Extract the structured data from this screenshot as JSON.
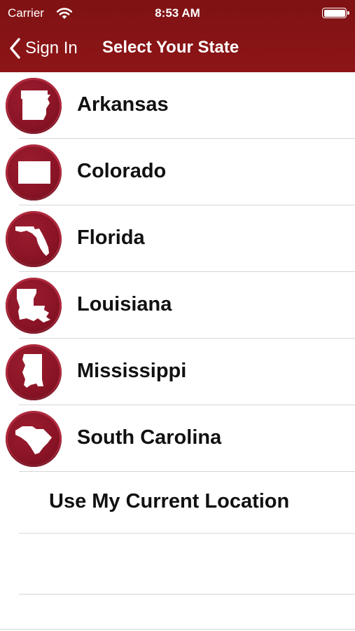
{
  "status_bar": {
    "carrier": "Carrier",
    "time": "8:53 AM"
  },
  "nav": {
    "back_label": "Sign In",
    "title": "Select Your State"
  },
  "theme": {
    "bar_color": "#8a1214",
    "badge_color": "#8a1426"
  },
  "states": [
    {
      "name": "Arkansas",
      "icon": "arkansas-icon"
    },
    {
      "name": "Colorado",
      "icon": "colorado-icon"
    },
    {
      "name": "Florida",
      "icon": "florida-icon"
    },
    {
      "name": "Louisiana",
      "icon": "louisiana-icon"
    },
    {
      "name": "Mississippi",
      "icon": "mississippi-icon"
    },
    {
      "name": "South Carolina",
      "icon": "south-carolina-icon"
    }
  ],
  "location_option": "Use My Current Location"
}
